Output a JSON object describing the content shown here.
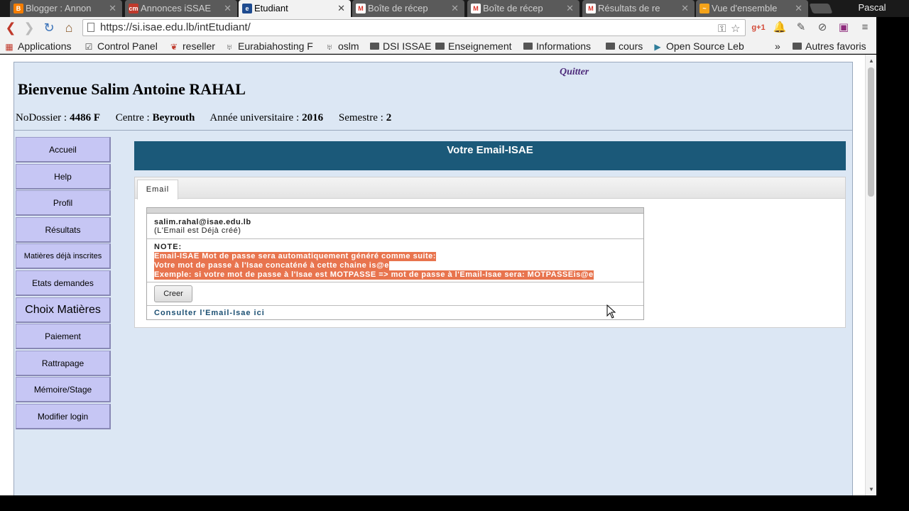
{
  "browser": {
    "tabs": [
      {
        "title": "Blogger : Annon",
        "favicon": "B",
        "color": "#f57d00"
      },
      {
        "title": "Annonces iSSAE",
        "favicon": "cm",
        "color": "#c0392b"
      },
      {
        "title": "Etudiant",
        "favicon": "e",
        "color": "#1e4b8f",
        "active": true
      },
      {
        "title": "Boîte de récep",
        "favicon": "M",
        "color": "#d93025"
      },
      {
        "title": "Boîte de récep",
        "favicon": "M",
        "color": "#d93025"
      },
      {
        "title": "Résultats de re",
        "favicon": "M",
        "color": "#d93025"
      },
      {
        "title": "Vue d'ensemble",
        "favicon": "~",
        "color": "#f4a31a"
      }
    ],
    "profile": "Pascal",
    "url": "https://si.isae.edu.lb/intEtudiant/",
    "bookmarks": [
      {
        "label": "Applications",
        "icon": "apps-grid-icon"
      },
      {
        "label": "Control Panel",
        "icon": "control-panel-icon"
      },
      {
        "label": "reseller",
        "icon": "reseller-icon"
      },
      {
        "label": "Eurabiahosting F",
        "icon": "hosting-icon"
      },
      {
        "label": "oslm",
        "icon": "hosting-icon"
      },
      {
        "label": "DSI ISSAE",
        "icon": "folder-icon"
      },
      {
        "label": "Enseignement",
        "icon": "folder-icon"
      },
      {
        "label": "Informations",
        "icon": "folder-icon"
      },
      {
        "label": "cours",
        "icon": "folder-icon"
      },
      {
        "label": "Open Source Leb",
        "icon": "play-icon"
      }
    ],
    "overflow": "»",
    "other_bookmarks": "Autres favoris"
  },
  "page": {
    "quit": "Quitter",
    "welcome": "Bienvenue Salim Antoine RAHAL",
    "info": {
      "dossier_label": "NoDossier :",
      "dossier_value": "4486 F",
      "centre_label": "Centre :",
      "centre_value": "Beyrouth",
      "annee_label": "Année universitaire :",
      "annee_value": "2016",
      "semestre_label": "Semestre :",
      "semestre_value": "2"
    },
    "sidebar": [
      "Accueil",
      "Help",
      "Profil",
      "Résultats",
      "Matières déjà inscrites",
      "Etats demandes",
      "Choix Matières",
      "Paiement",
      "Rattrapage",
      "Mémoire/Stage",
      "Modifier login"
    ],
    "banner": "Votre Email-ISAE",
    "tab_email": "Email",
    "email_address": "salim.rahal@isae.edu.lb",
    "email_status": "(L'Email est Déjà créé)",
    "note_label": "NOTE:",
    "note_lines": [
      "Email-ISAE Mot de passe sera automatiquement généré comme suite: ",
      "Votre mot de passe à l'Isae concaténé à cette chaine is@e ",
      "Exemple: si votre mot de passe à l'Isae est MOTPASSE => mot de passe à l'Email-Isae sera: MOTPASSEis@e"
    ],
    "create_button": "Creer",
    "consult_link": "Consulter l'Email-Isae ici"
  }
}
